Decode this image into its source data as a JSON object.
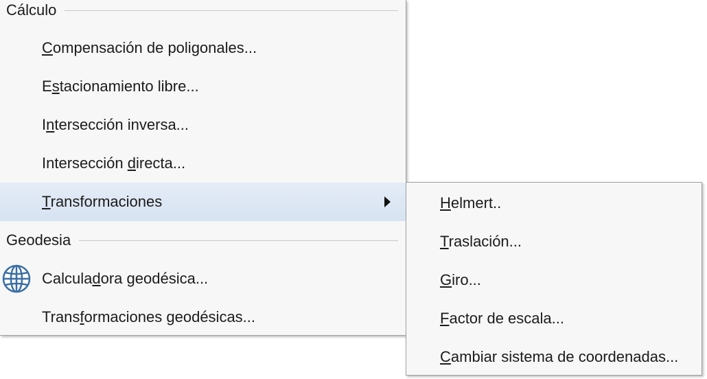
{
  "main_menu": {
    "sections": [
      {
        "header": "Cálculo",
        "items": [
          {
            "pre": "",
            "key": "C",
            "post": "ompensación de poligonales..."
          },
          {
            "pre": "E",
            "key": "s",
            "post": "tacionamiento libre..."
          },
          {
            "pre": "I",
            "key": "n",
            "post": "tersección inversa..."
          },
          {
            "pre": "Intersección ",
            "key": "d",
            "post": "irecta..."
          },
          {
            "pre": "",
            "key": "T",
            "post": "ransformaciones",
            "has_submenu": true,
            "highlighted": true
          }
        ]
      },
      {
        "header": "Geodesia",
        "items": [
          {
            "pre": "Calcula",
            "key": "d",
            "post": "ora geodésica...",
            "icon": "globe-icon"
          },
          {
            "pre": "Trans",
            "key": "f",
            "post": "ormaciones geodésicas..."
          }
        ]
      }
    ]
  },
  "sub_menu": {
    "items": [
      {
        "pre": "",
        "key": "H",
        "post": "elmert.."
      },
      {
        "pre": "",
        "key": "T",
        "post": "raslación..."
      },
      {
        "pre": "",
        "key": "G",
        "post": "iro..."
      },
      {
        "pre": "",
        "key": "F",
        "post": "actor de escala..."
      },
      {
        "pre": "",
        "key": "C",
        "post": "ambiar sistema de coordenadas..."
      }
    ]
  },
  "colors": {
    "menu_background": "#f7f7f7",
    "highlight": "#dce6f4",
    "text": "#1b1b1b",
    "separator": "#c8c8c8",
    "globe": "#3a6ea5"
  }
}
